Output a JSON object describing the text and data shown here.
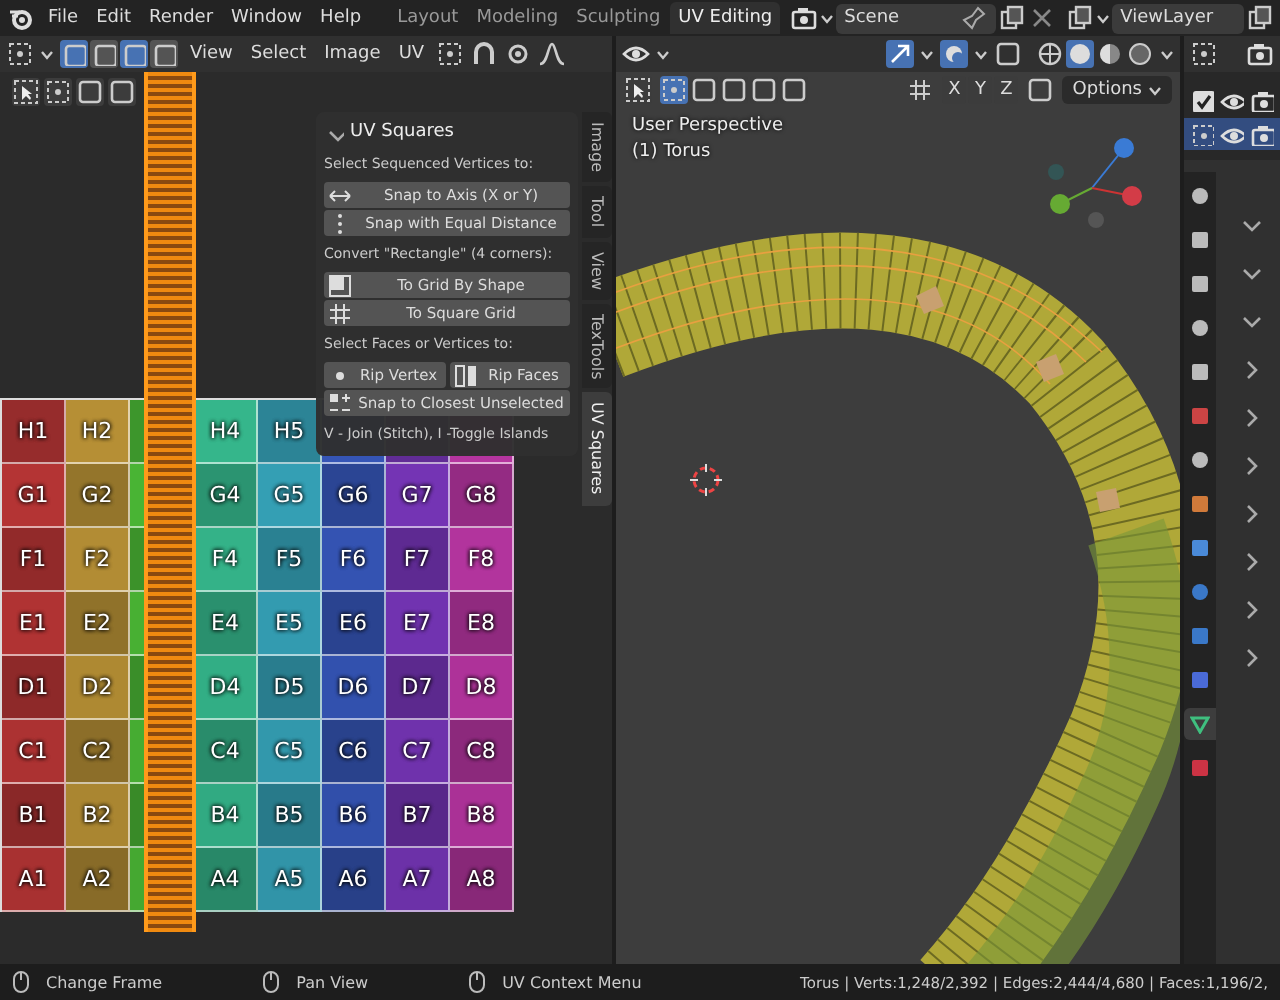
{
  "topbar": {
    "menus": [
      "File",
      "Edit",
      "Render",
      "Window",
      "Help"
    ],
    "workspaces": [
      {
        "label": "Layout",
        "selected": false
      },
      {
        "label": "Modeling",
        "selected": false
      },
      {
        "label": "Sculpting",
        "selected": false
      },
      {
        "label": "UV Editing",
        "selected": true
      }
    ],
    "scene": "Scene",
    "view_layer": "ViewLayer"
  },
  "uv_editor": {
    "menus": [
      "View",
      "Select",
      "Image",
      "UV"
    ],
    "select_modes": [
      {
        "selected": true
      },
      {
        "selected": false
      },
      {
        "selected": true
      },
      {
        "selected": false
      }
    ],
    "grid": [
      [
        {
          "kind": "label",
          "text": "H1"
        },
        {
          "kind": "label",
          "text": "H2"
        },
        {
          "kind": "covered"
        },
        {
          "kind": "label",
          "text": "H4"
        },
        {
          "kind": "label",
          "text": "H5"
        },
        {
          "kind": "covered"
        },
        {
          "kind": "covered"
        },
        {
          "kind": "covered"
        }
      ],
      [
        {
          "kind": "label",
          "text": "G1"
        },
        {
          "kind": "label",
          "text": "G2"
        },
        {
          "kind": "covered"
        },
        {
          "kind": "label",
          "text": "G4"
        },
        {
          "kind": "label",
          "text": "G5"
        },
        {
          "kind": "label",
          "text": "G6"
        },
        {
          "kind": "label",
          "text": "G7"
        },
        {
          "kind": "label",
          "text": "G8"
        }
      ],
      [
        {
          "kind": "label",
          "text": "F1"
        },
        {
          "kind": "label",
          "text": "F2"
        },
        {
          "kind": "covered"
        },
        {
          "kind": "label",
          "text": "F4"
        },
        {
          "kind": "label",
          "text": "F5"
        },
        {
          "kind": "label",
          "text": "F6"
        },
        {
          "kind": "label",
          "text": "F7"
        },
        {
          "kind": "label",
          "text": "F8"
        }
      ],
      [
        {
          "kind": "label",
          "text": "E1"
        },
        {
          "kind": "label",
          "text": "E2"
        },
        {
          "kind": "covered"
        },
        {
          "kind": "label",
          "text": "E4"
        },
        {
          "kind": "label",
          "text": "E5"
        },
        {
          "kind": "label",
          "text": "E6"
        },
        {
          "kind": "label",
          "text": "E7"
        },
        {
          "kind": "label",
          "text": "E8"
        }
      ],
      [
        {
          "kind": "label",
          "text": "D1"
        },
        {
          "kind": "label",
          "text": "D2"
        },
        {
          "kind": "covered"
        },
        {
          "kind": "label",
          "text": "D4"
        },
        {
          "kind": "label",
          "text": "D5"
        },
        {
          "kind": "label",
          "text": "D6"
        },
        {
          "kind": "label",
          "text": "D7"
        },
        {
          "kind": "label",
          "text": "D8"
        }
      ],
      [
        {
          "kind": "label",
          "text": "C1"
        },
        {
          "kind": "label",
          "text": "C2"
        },
        {
          "kind": "covered"
        },
        {
          "kind": "label",
          "text": "C4"
        },
        {
          "kind": "label",
          "text": "C5"
        },
        {
          "kind": "label",
          "text": "C6"
        },
        {
          "kind": "label",
          "text": "C7"
        },
        {
          "kind": "label",
          "text": "C8"
        }
      ],
      [
        {
          "kind": "label",
          "text": "B1"
        },
        {
          "kind": "label",
          "text": "B2"
        },
        {
          "kind": "covered"
        },
        {
          "kind": "label",
          "text": "B4"
        },
        {
          "kind": "label",
          "text": "B5"
        },
        {
          "kind": "label",
          "text": "B6"
        },
        {
          "kind": "label",
          "text": "B7"
        },
        {
          "kind": "label",
          "text": "B8"
        }
      ],
      [
        {
          "kind": "label",
          "text": "A1"
        },
        {
          "kind": "label",
          "text": "A2"
        },
        {
          "kind": "covered"
        },
        {
          "kind": "label",
          "text": "A4"
        },
        {
          "kind": "label",
          "text": "A5"
        },
        {
          "kind": "label",
          "text": "A6"
        },
        {
          "kind": "label",
          "text": "A7"
        },
        {
          "kind": "label",
          "text": "A8"
        }
      ]
    ],
    "side_tabs": [
      {
        "label": "Image",
        "selected": false
      },
      {
        "label": "Tool",
        "selected": false
      },
      {
        "label": "View",
        "selected": false
      },
      {
        "label": "TexTools",
        "selected": false
      },
      {
        "label": "UV Squares",
        "selected": true
      }
    ],
    "panel": {
      "title": "UV Squares",
      "sections": [
        {
          "label": "Select Sequenced Vertices to:",
          "rows": [
            [
              {
                "kind": "arrows",
                "label": "Snap to Axis (X or Y)"
              }
            ],
            [
              {
                "kind": "dots",
                "label": "Snap with Equal Distance"
              }
            ]
          ]
        },
        {
          "label": "Convert \"Rectangle\" (4 corners):",
          "rows": [
            [
              {
                "kind": "shape",
                "label": "To Grid By Shape"
              }
            ],
            [
              {
                "kind": "grid",
                "label": "To Square Grid"
              }
            ]
          ]
        },
        {
          "label": "Select Faces or Vertices to:",
          "rows": [
            [
              {
                "kind": "dot",
                "label": "Rip Vertex"
              },
              {
                "kind": "faces",
                "label": "Rip Faces"
              }
            ],
            [
              {
                "kind": "snap",
                "label": "Snap to Closest Unselected"
              }
            ]
          ]
        }
      ],
      "hint": "V - Join (Stitch), I -Toggle Islands"
    }
  },
  "viewport": {
    "overlay_lines": [
      "User Perspective",
      "(1) Torus"
    ],
    "axis_buttons": [
      "X",
      "Y",
      "Z"
    ],
    "options": "Options"
  },
  "outliner_rows": [
    {
      "selected": false
    },
    {
      "selected": true
    }
  ],
  "properties_tabs": [
    {
      "selected": false
    },
    {
      "selected": false
    },
    {
      "selected": false
    },
    {
      "selected": false
    },
    {
      "selected": false
    },
    {
      "selected": false
    },
    {
      "selected": false
    },
    {
      "selected": false
    },
    {
      "selected": false
    },
    {
      "selected": false
    },
    {
      "selected": false
    },
    {
      "selected": false
    },
    {
      "selected": true
    },
    {
      "selected": false
    }
  ],
  "status_bar": {
    "hints": [
      "Change Frame",
      "Pan View",
      "UV Context Menu"
    ],
    "stats": "Torus | Verts:1,248/2,392 | Edges:2,444/4,680 | Faces:1,196/2,"
  }
}
